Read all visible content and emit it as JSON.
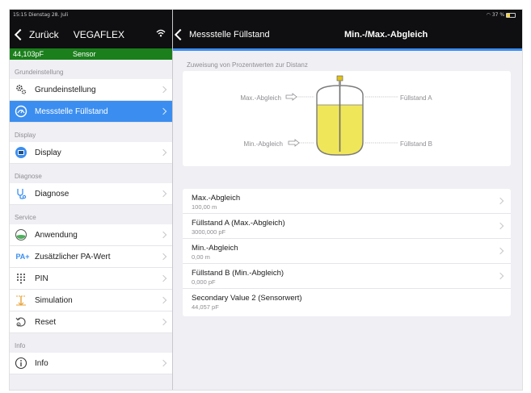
{
  "status": {
    "time_date": "15:15  Dienstag 28. Juli",
    "battery": "37 %"
  },
  "sidebar": {
    "back_label": "Zurück",
    "title": "VEGAFLEX",
    "sensor_value": "44,103pF",
    "sensor_label": "Sensor",
    "groups": [
      {
        "header": "Grundeinstellung",
        "items": [
          {
            "label": "Grundeinstellung",
            "icon": "gears-icon",
            "active": false
          },
          {
            "label": "Messstelle Füllstand",
            "icon": "gauge-icon",
            "active": true
          }
        ]
      },
      {
        "header": "Display",
        "items": [
          {
            "label": "Display",
            "icon": "display-icon",
            "active": false
          }
        ]
      },
      {
        "header": "Diagnose",
        "items": [
          {
            "label": "Diagnose",
            "icon": "stethoscope-icon",
            "active": false
          }
        ]
      },
      {
        "header": "Service",
        "items": [
          {
            "label": "Anwendung",
            "icon": "application-icon",
            "active": false
          },
          {
            "label": "Zusätzlicher PA-Wert",
            "icon": "pa-plus-icon",
            "icon_text": "PA+",
            "active": false
          },
          {
            "label": "PIN",
            "icon": "keypad-icon",
            "active": false
          },
          {
            "label": "Simulation",
            "icon": "simulation-icon",
            "active": false
          },
          {
            "label": "Reset",
            "icon": "reset-icon",
            "active": false
          }
        ]
      },
      {
        "header": "Info",
        "items": [
          {
            "label": "Info",
            "icon": "info-icon",
            "active": false
          }
        ]
      }
    ]
  },
  "main": {
    "back_label": "Messstelle Füllstand",
    "title": "Min.-/Max.-Abgleich",
    "section_label": "Zuweisung von Prozentwerten zur Distanz",
    "diagram": {
      "max_label": "Max.-Abgleich",
      "min_label": "Min.-Abgleich",
      "level_a": "Füllstand A",
      "level_b": "Füllstand B",
      "liquid_color": "#f0e65a"
    },
    "rows": [
      {
        "label": "Max.-Abgleich",
        "value": "100,00 m",
        "has_chevron": true
      },
      {
        "label": "Füllstand A (Max.-Abgleich)",
        "value": "3000,000 pF",
        "has_chevron": true
      },
      {
        "label": "Min.-Abgleich",
        "value": "0,00 m",
        "has_chevron": true
      },
      {
        "label": "Füllstand B (Min.-Abgleich)",
        "value": "0,000 pF",
        "has_chevron": true
      },
      {
        "label": "Secondary Value 2 (Sensorwert)",
        "value": "44,057 pF",
        "has_chevron": false
      }
    ]
  },
  "colors": {
    "accent": "#3b8ef0",
    "sensor_bar": "#1b7f1c",
    "navbar": "#0f0f11"
  }
}
